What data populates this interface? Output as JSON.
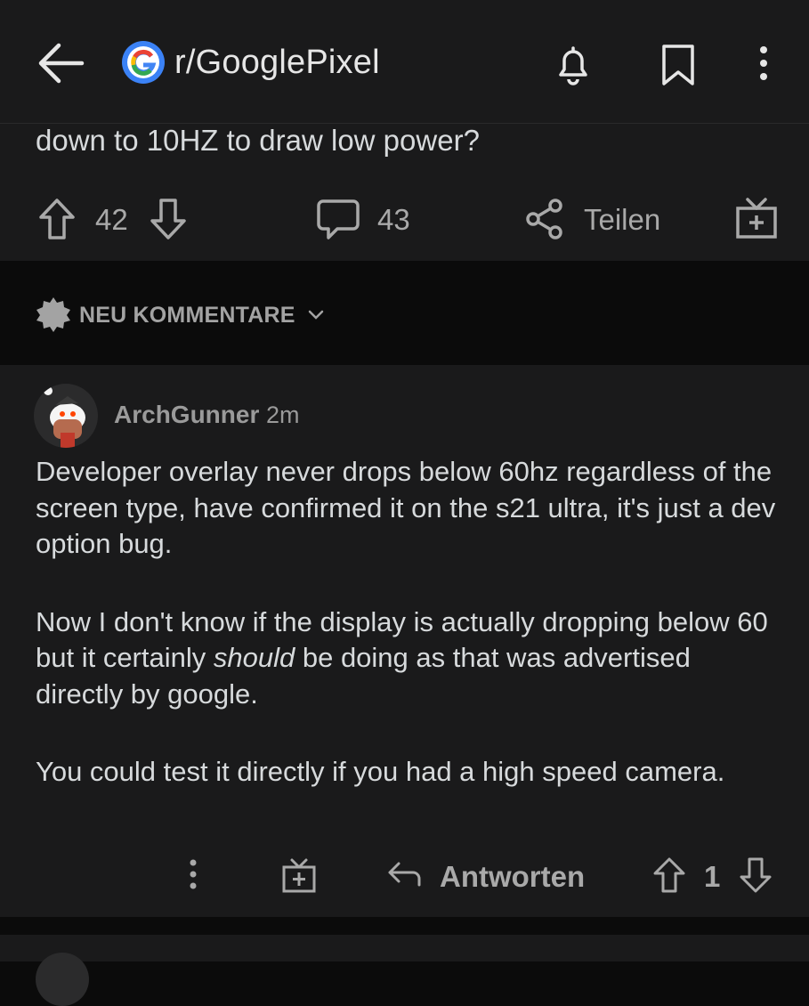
{
  "header": {
    "subreddit": "r/GooglePixel",
    "icons": [
      "back-arrow-icon",
      "google-g-icon",
      "bell-icon",
      "bookmark-icon",
      "more-vertical-icon"
    ]
  },
  "post": {
    "text_fragment": "down to 10HZ to draw low power?",
    "upvotes": "42",
    "comments": "43",
    "share_label": "Teilen"
  },
  "sort": {
    "label": "NEU KOMMENTARE"
  },
  "comment": {
    "author": "ArchGunner",
    "age": "2m",
    "p1": "Developer overlay never drops below 60hz regardless of the screen type, have confirmed it on the s21 ultra, it's just a dev option bug.",
    "p2_before": "Now I don't know if the display is actually dropping below 60 but it certainly ",
    "p2_em": "should",
    "p2_after": " be doing as that was advertised directly by google.",
    "p3": "You could test it directly if you had a high speed camera.",
    "reply_label": "Antworten",
    "score": "1"
  },
  "colors": {
    "background": "#0b0b0b",
    "surface": "#1a1a1b",
    "text": "#d7dadc",
    "muted": "#a9a9a9",
    "google_blue": "#3b82f6"
  }
}
